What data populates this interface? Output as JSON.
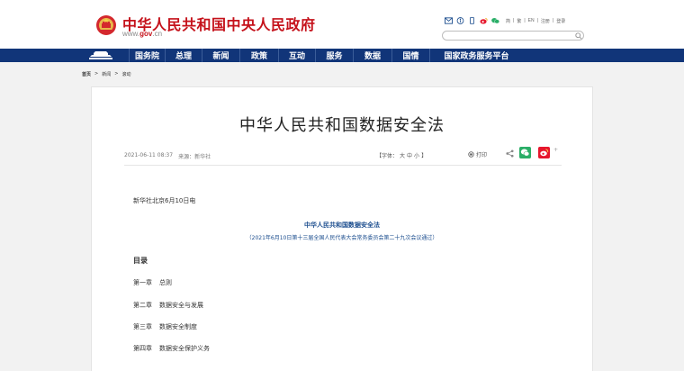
{
  "header": {
    "site_title": "中华人民共和国中央人民政府",
    "site_url_prefix": "www.",
    "site_url_brand": "gov",
    "site_url_suffix": ".cn",
    "lang_links": [
      "简",
      "繁",
      "EN",
      "注册",
      "登录"
    ],
    "search": {
      "value": "",
      "placeholder": ""
    },
    "icons": [
      "mail-icon",
      "accessibility-icon",
      "mobile-icon",
      "weibo-icon",
      "wechat-icon"
    ]
  },
  "nav": {
    "items": [
      "国务院",
      "总理",
      "新闻",
      "政策",
      "互动",
      "服务",
      "数据",
      "国情",
      "国家政务服务平台"
    ]
  },
  "breadcrumb": [
    "首页",
    ">",
    "新闻",
    ">",
    "滚动"
  ],
  "article": {
    "title": "中华人民共和国数据安全法",
    "datetime": "2021-06-11 08:37",
    "source_label": "来源：",
    "source": "新华社",
    "font_label": "【字体：",
    "font_large": "大",
    "font_medium": "中",
    "font_small": "小",
    "font_close": "】",
    "print_label": "打印",
    "more_label": "+",
    "dateline": "新华社北京6月10日电",
    "law_title": "中华人民共和国数据安全法",
    "law_sub": "（2021年6月10日第十三届全国人民代表大会常务委员会第二十九次会议通过）",
    "toc_heading": "目录",
    "chapters": [
      {
        "num": "第一章",
        "name": "总则"
      },
      {
        "num": "第二章",
        "name": "数据安全与发展"
      },
      {
        "num": "第三章",
        "name": "数据安全制度"
      },
      {
        "num": "第四章",
        "name": "数据安全保护义务"
      }
    ]
  },
  "colors": {
    "brand_red": "#c5121b",
    "nav_blue": "#113579",
    "link_blue": "#1b4d8e"
  }
}
